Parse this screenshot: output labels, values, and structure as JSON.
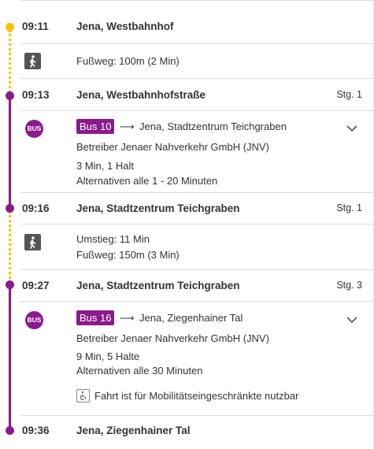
{
  "stops": [
    {
      "time": "09:11",
      "name": "Jena, Westbahnhof",
      "platform": ""
    },
    {
      "time": "09:13",
      "name": "Jena, Westbahnhofstraße",
      "platform": "Stg. 1"
    },
    {
      "time": "09:16",
      "name": "Jena, Stadtzentrum Teichgraben",
      "platform": "Stg. 1"
    },
    {
      "time": "09:27",
      "name": "Jena, Stadtzentrum Teichgraben",
      "platform": "Stg. 3"
    },
    {
      "time": "09:36",
      "name": "Jena, Ziegenhainer Tal",
      "platform": ""
    }
  ],
  "walk1": {
    "icon": "pedestrian-icon",
    "text": "Fußweg: 100m (2 Min)"
  },
  "leg1": {
    "icon_label": "BUS",
    "line": "Bus 10",
    "arrow": "⟶",
    "destination": "Jena, Stadtzentrum Teichgraben",
    "operator": "Betreiber Jenaer Nahverkehr GmbH (JNV)",
    "duration": "3 Min, 1 Halt",
    "alternatives": "Alternativen alle 1 - 20 Minuten"
  },
  "walk2": {
    "icon": "pedestrian-icon",
    "transfer": "Umstieg: 11 Min",
    "text": "Fußweg: 150m (3 Min)"
  },
  "leg2": {
    "icon_label": "BUS",
    "line": "Bus 16",
    "arrow": "⟶",
    "destination": "Jena, Ziegenhainer Tal",
    "operator": "Betreiber Jenaer Nahverkehr GmbH (JNV)",
    "duration": "9 Min, 5 Halte",
    "alternatives": "Alternativen alle 30 Minuten",
    "accessibility": "Fahrt ist für Mobilitätseingeschränkte nutzbar"
  },
  "colors": {
    "bus_line": "#8b1a8c",
    "walk_line": "#f5c400"
  }
}
